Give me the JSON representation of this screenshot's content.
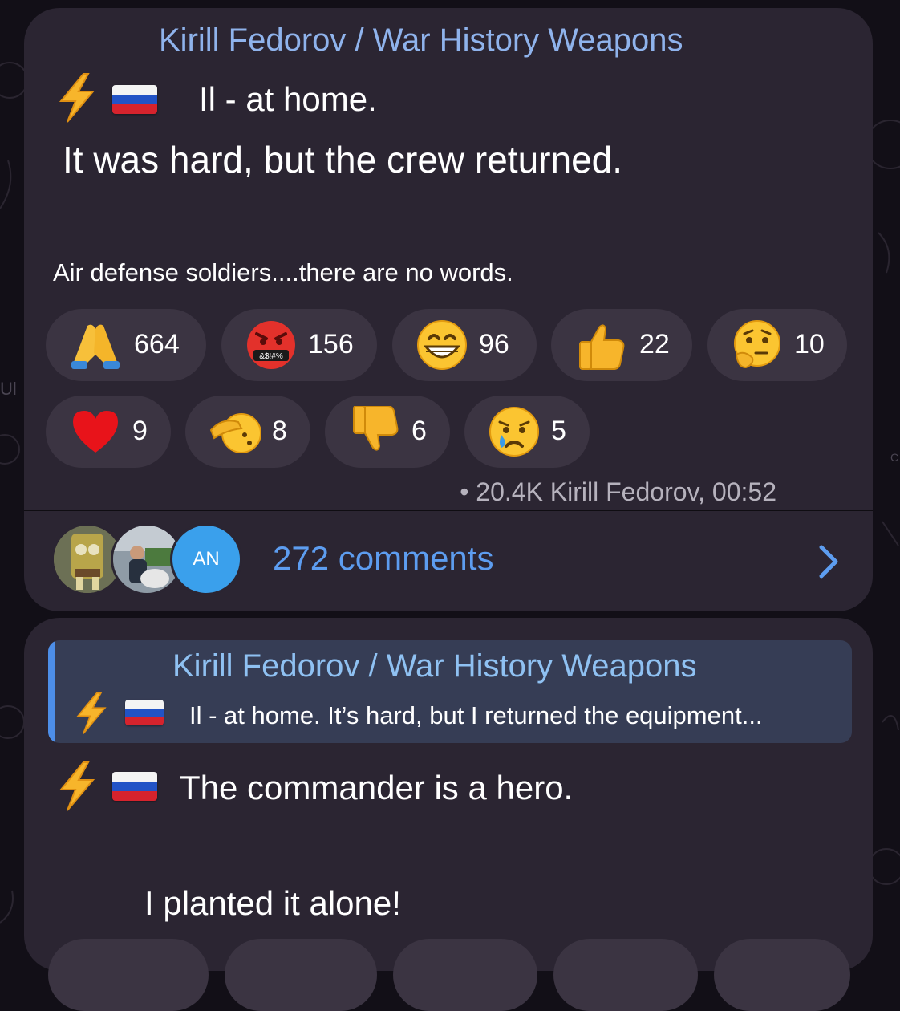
{
  "post1": {
    "channel": "Kirill Fedorov / War History Weapons",
    "headline": "Il - at home.",
    "line2": "It was hard, but the crew returned.",
    "line3": "Air defense soldiers....there are no words.",
    "reactions": [
      {
        "emoji": "folded-hands",
        "count": "664"
      },
      {
        "emoji": "cursing-face",
        "count": "156"
      },
      {
        "emoji": "grinning-face",
        "count": "96"
      },
      {
        "emoji": "thumbs-up",
        "count": "22"
      },
      {
        "emoji": "thinking-face",
        "count": "10"
      },
      {
        "emoji": "red-heart",
        "count": "9"
      },
      {
        "emoji": "saluting-face",
        "count": "8"
      },
      {
        "emoji": "thumbs-down",
        "count": "6"
      },
      {
        "emoji": "crying-face",
        "count": "5"
      }
    ],
    "cursing_symbols": "&$!#%",
    "meta": "• 20.4K Kirill Fedorov, 00:52",
    "avatar_initials": "AN",
    "comments": "272 comments"
  },
  "post2": {
    "quote_channel": "Kirill Fedorov / War History Weapons",
    "quote_text": "Il - at home. It’s hard, but I returned the equipment...",
    "line1": "The commander is a hero.",
    "line2": "I planted it alone!"
  },
  "colors": {
    "background": "#120f17",
    "bubble": "#2b2532",
    "reaction_pill": "#3b3442",
    "link_blue": "#5d9df0",
    "channel_title": "#8fb3ec",
    "quote_bar": "#4d8ee8"
  }
}
